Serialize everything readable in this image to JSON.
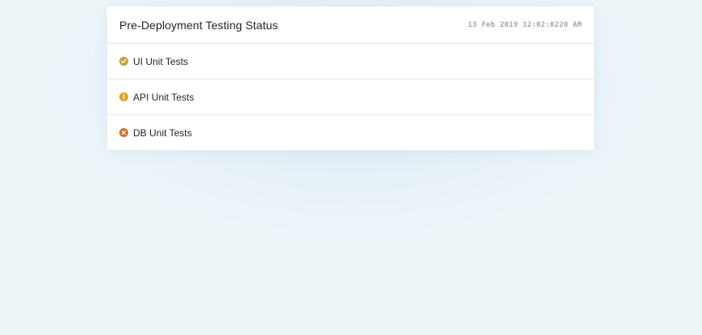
{
  "panel": {
    "title": "Pre-Deployment Testing Status",
    "timestamp": "13 Feb 2019 12:02:0220 AM"
  },
  "tests": [
    {
      "label": "UI Unit Tests",
      "status": "passed",
      "icon": "check-circle-icon",
      "color": "#c2a33a"
    },
    {
      "label": "API Unit Tests",
      "status": "warning",
      "icon": "exclamation-circle-icon",
      "color": "#e1a21c"
    },
    {
      "label": "DB Unit Tests",
      "status": "failed",
      "icon": "x-circle-icon",
      "color": "#d2742b"
    }
  ]
}
